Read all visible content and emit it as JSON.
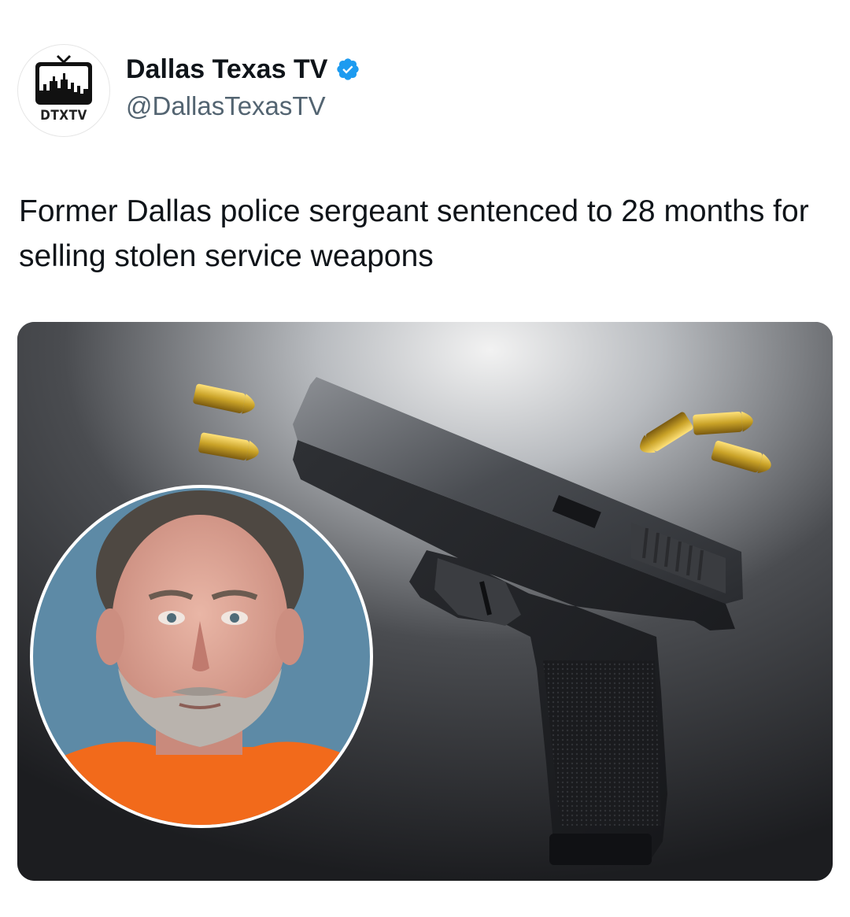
{
  "account": {
    "display_name": "Dallas Texas TV",
    "handle": "@DallasTexasTV",
    "avatar_text": "DTXTV",
    "verified": true
  },
  "tweet": {
    "text": "Former Dallas police sergeant sentenced to 28 months for selling stolen service weapons"
  },
  "media": {
    "description_icons": [
      "pistol",
      "bullets",
      "mugshot"
    ]
  },
  "colors": {
    "text_primary": "#0f1419",
    "text_secondary": "#536471",
    "verified_blue": "#1d9bf0",
    "brass": "#c9a227",
    "orange_shirt": "#f26a1b"
  }
}
